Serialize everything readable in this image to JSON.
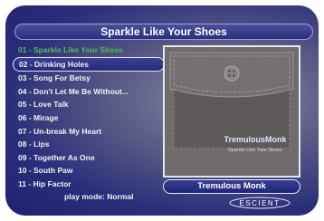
{
  "header": {
    "album_title": "Sparkle Like Your Shoes"
  },
  "tracks": [
    {
      "label": "01 - Sparkle Like Your Shoes",
      "state": "playing"
    },
    {
      "label": "02 - Drinking Holes",
      "state": "selected"
    },
    {
      "label": "03 - Song For Betsy",
      "state": "normal"
    },
    {
      "label": "04 - Don't Let Me Be Without...",
      "state": "normal"
    },
    {
      "label": "05 - Love Talk",
      "state": "normal"
    },
    {
      "label": "06 - Mirage",
      "state": "normal"
    },
    {
      "label": "07 - Un-break My Heart",
      "state": "normal"
    },
    {
      "label": "08 - Lips",
      "state": "normal"
    },
    {
      "label": "09 - Together As One",
      "state": "normal"
    },
    {
      "label": "10 - South Paw",
      "state": "normal"
    },
    {
      "label": "11 - Hip Factor",
      "state": "normal"
    }
  ],
  "play_mode": {
    "text": "play mode: Normal"
  },
  "album_art": {
    "artist_text": "TremulousMonk",
    "album_text": "Sparkle Like Your Shoes"
  },
  "now_playing": {
    "artist": "Tremulous Monk"
  },
  "brand": {
    "logo_text": "ESCIENT"
  },
  "colors": {
    "accent": "#2a2f7d",
    "playing": "#4cc04c",
    "text": "#f2f2f2"
  }
}
